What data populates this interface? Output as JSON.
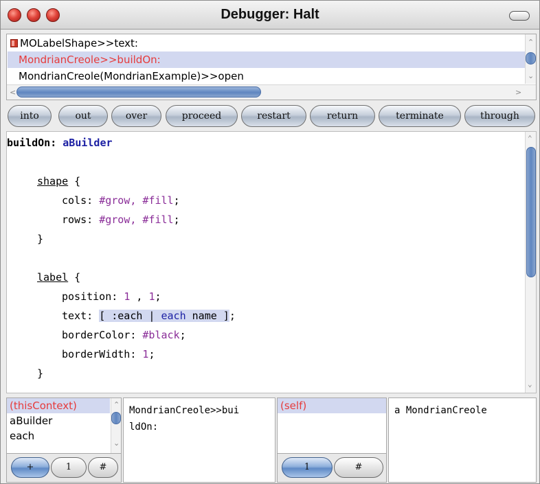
{
  "window": {
    "title": "Debugger: Halt"
  },
  "stack": {
    "frames": [
      "MOLabelShape>>text:",
      "MondrianCreole>>buildOn:",
      "MondrianCreole(MondrianExample)>>open"
    ]
  },
  "buttons": [
    "into",
    "out",
    "over",
    "proceed",
    "restart",
    "return",
    "terminate",
    "through"
  ],
  "code": {
    "signature_selector": "buildOn:",
    "signature_arg": "aBuilder",
    "shape_kw": "shape",
    "brace_open": " {",
    "cols_label": "cols: ",
    "cols_val": "#grow, #fill",
    "rows_label": "rows: ",
    "rows_val": "#grow, #fill",
    "semi": ";",
    "brace_close": "}",
    "label_kw": "label",
    "position_label": "position: ",
    "position_v1": "1",
    "position_sep": " , ",
    "position_v2": "1",
    "text_label": "text: ",
    "block_open": "[ :each | ",
    "block_each": "each",
    "block_rest": " name ]",
    "border_color_label": "borderColor: ",
    "border_color_val": "#black",
    "border_width_label": "borderWidth: ",
    "border_width_val": "1"
  },
  "context_inspector": {
    "items": [
      "(thisContext)",
      "aBuilder",
      "each"
    ],
    "value": "MondrianCreole>>buildOn:",
    "value_line1": "MondrianCreole>>bui",
    "value_line2": "ldOn:",
    "buttons": [
      "+",
      "1",
      "#"
    ]
  },
  "receiver_inspector": {
    "items": [
      "(self)"
    ],
    "value": "a MondrianCreole",
    "buttons": [
      "1",
      "#"
    ]
  }
}
